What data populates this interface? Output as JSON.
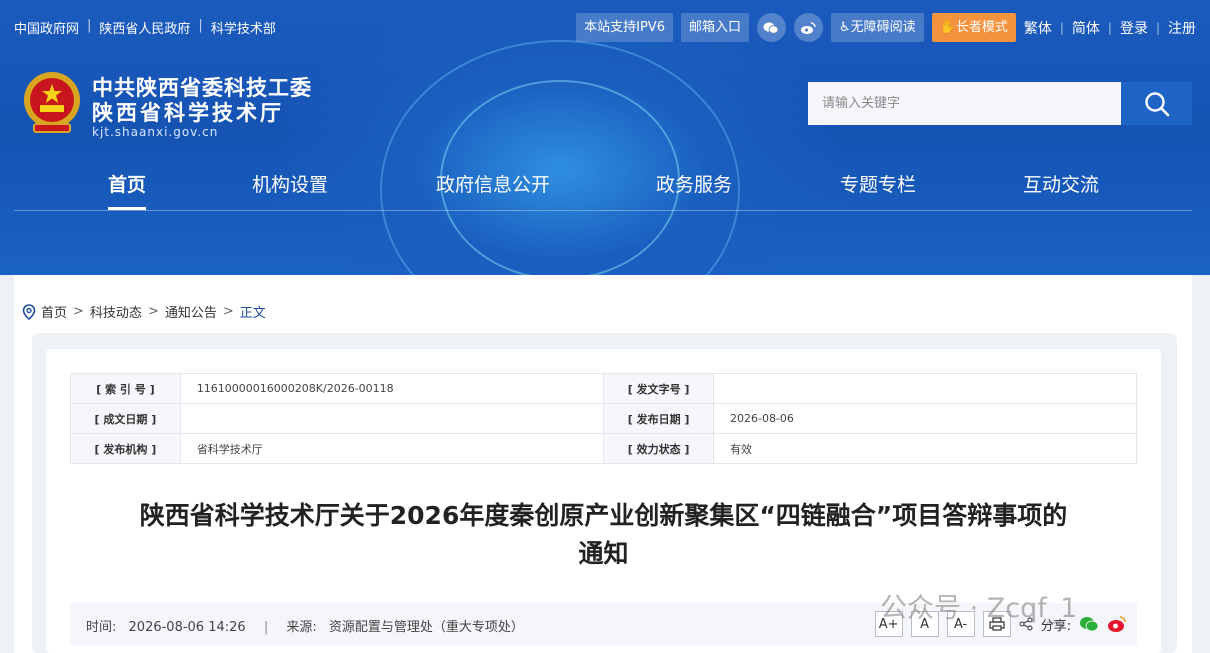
{
  "topbar": {
    "links": [
      "中国政府网",
      "陕西省人民政府",
      "科学技术部"
    ],
    "ipv6": "本站支持IPV6",
    "mailbox": "邮箱入口",
    "accessibility": "无障碍阅读",
    "elder_mode": "长者模式",
    "traditional": "繁体",
    "simplified": "简体",
    "login": "登录",
    "register": "注册"
  },
  "site": {
    "name_line1": "中共陕西省委科技工委",
    "name_line2": "陕西省科学技术厅",
    "domain": "kjt.shaanxi.gov.cn"
  },
  "search": {
    "placeholder": "请输入关键字"
  },
  "nav": [
    "首页",
    "机构设置",
    "政府信息公开",
    "政务服务",
    "专题专栏",
    "互动交流"
  ],
  "breadcrumb": [
    "首页",
    "科技动态",
    "通知公告",
    "正文"
  ],
  "meta": {
    "index_no_label": "[ 索 引 号 ]",
    "index_no": "11610000016000208K/2026-00118",
    "doc_no_label": "[ 发文字号 ]",
    "doc_no": "",
    "written_date_label": "[ 成文日期 ]",
    "written_date": "",
    "publish_date_label": "[ 发布日期 ]",
    "publish_date": "2026-08-06",
    "issuer_label": "[ 发布机构 ]",
    "issuer": "省科学技术厅",
    "status_label": "[ 效力状态 ]",
    "status": "有效"
  },
  "article": {
    "title_line1": "陕西省科学技术厅关于2026年度秦创原产业创新聚集区“四链融合”项目答辩事项的",
    "title_line2": "通知",
    "time_label": "时间:",
    "time": "2026-08-06 14:26",
    "source_label": "来源:",
    "source": "资源配置与管理处（重大专项处）",
    "font_buttons": [
      "A+",
      "A",
      "A-"
    ],
    "share_label": "分享:"
  },
  "watermark": "公众号 · Zcqf_1",
  "colors": {
    "elder": "#f5923e",
    "nav_bg": "#1553b3",
    "valid": "#2a8a2a",
    "breadcrumb_current": "#1d4e9e"
  }
}
